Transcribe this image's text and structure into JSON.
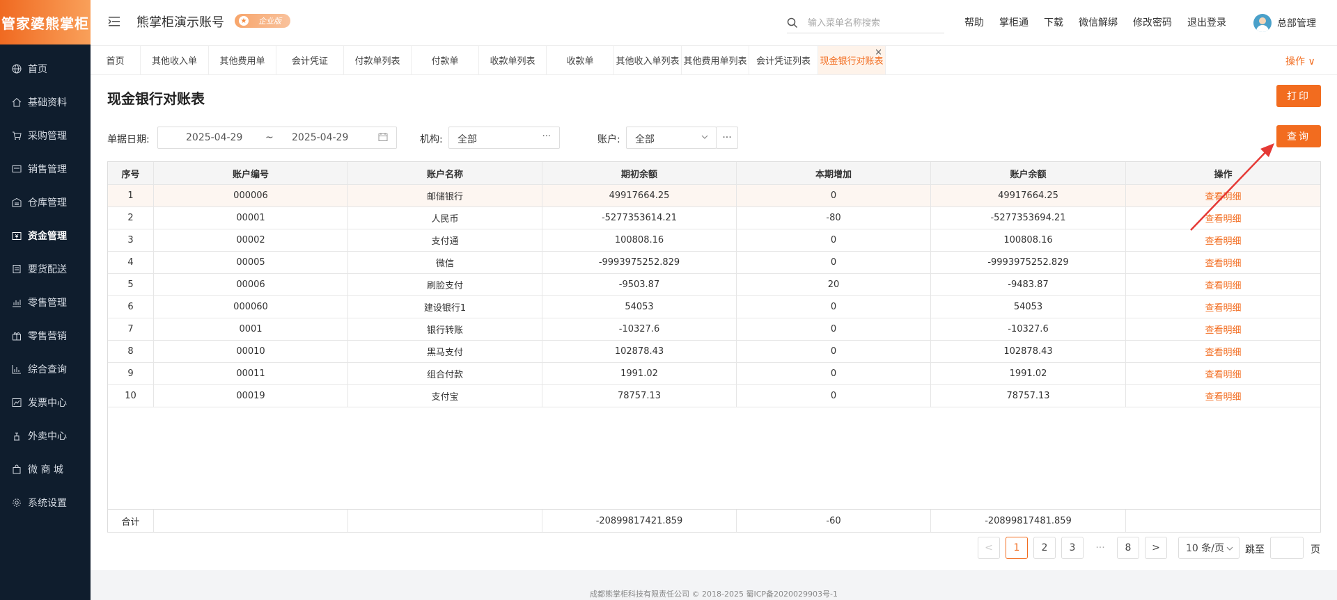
{
  "sidebar": {
    "logo": "管家婆熊掌柜",
    "items": [
      {
        "label": "首页",
        "icon": "globe-icon"
      },
      {
        "label": "基础资料",
        "icon": "home-icon"
      },
      {
        "label": "采购管理",
        "icon": "cart-icon"
      },
      {
        "label": "销售管理",
        "icon": "sales-icon"
      },
      {
        "label": "仓库管理",
        "icon": "warehouse-icon"
      },
      {
        "label": "资金管理",
        "icon": "funds-icon"
      },
      {
        "label": "要货配送",
        "icon": "delivery-icon"
      },
      {
        "label": "零售管理",
        "icon": "retail-chart-icon"
      },
      {
        "label": "零售营销",
        "icon": "gift-icon"
      },
      {
        "label": "综合查询",
        "icon": "bar-chart-icon"
      },
      {
        "label": "发票中心",
        "icon": "line-chart-icon"
      },
      {
        "label": "外卖中心",
        "icon": "takeout-icon"
      },
      {
        "label": "微 商 城",
        "icon": "shop-bag-icon"
      },
      {
        "label": "系统设置",
        "icon": "gear-icon"
      }
    ]
  },
  "header": {
    "account_title": "熊掌柜演示账号",
    "edition_badge": "企业版",
    "search_placeholder": "输入菜单名称搜索",
    "links": [
      "帮助",
      "掌柜通",
      "下载",
      "微信解绑",
      "修改密码",
      "退出登录"
    ],
    "user_name": "总部管理"
  },
  "tabs": {
    "items": [
      "首页",
      "其他收入单",
      "其他费用单",
      "会计凭证",
      "付款单列表",
      "付款单",
      "收款单列表",
      "收款单",
      "其他收入单列表",
      "其他费用单列表",
      "会计凭证列表",
      "现金银行对账表"
    ],
    "active_index": 11,
    "ops_label": "操作 ∨"
  },
  "page": {
    "title": "现金银行对账表",
    "print_button": "打印",
    "query_button": "查询"
  },
  "filters": {
    "date_label": "单据日期:",
    "date_start": "2025-04-29",
    "date_sep": "~",
    "date_end": "2025-04-29",
    "org_label": "机构:",
    "org_value": "全部",
    "account_label": "账户:",
    "account_value": "全部",
    "more": "···"
  },
  "table": {
    "headers": [
      "序号",
      "账户编号",
      "账户名称",
      "期初余额",
      "本期增加",
      "账户余额",
      "操作"
    ],
    "rows": [
      [
        "1",
        "000006",
        "邮储银行",
        "49917664.25",
        "0",
        "49917664.25",
        "查看明细"
      ],
      [
        "2",
        "00001",
        "人民币",
        "-5277353614.21",
        "-80",
        "-5277353694.21",
        "查看明细"
      ],
      [
        "3",
        "00002",
        "支付通",
        "100808.16",
        "0",
        "100808.16",
        "查看明细"
      ],
      [
        "4",
        "00005",
        "微信",
        "-9993975252.829",
        "0",
        "-9993975252.829",
        "查看明细"
      ],
      [
        "5",
        "00006",
        "刷脸支付",
        "-9503.87",
        "20",
        "-9483.87",
        "查看明细"
      ],
      [
        "6",
        "000060",
        "建设银行1",
        "54053",
        "0",
        "54053",
        "查看明细"
      ],
      [
        "7",
        "0001",
        "银行转账",
        "-10327.6",
        "0",
        "-10327.6",
        "查看明细"
      ],
      [
        "8",
        "00010",
        "黑马支付",
        "102878.43",
        "0",
        "102878.43",
        "查看明细"
      ],
      [
        "9",
        "00011",
        "组合付款",
        "1991.02",
        "0",
        "1991.02",
        "查看明细"
      ],
      [
        "10",
        "00019",
        "支付宝",
        "78757.13",
        "0",
        "78757.13",
        "查看明细"
      ]
    ],
    "summary": {
      "label": "合计",
      "opening": "-20899817421.859",
      "increase": "-60",
      "balance": "-20899817481.859"
    }
  },
  "pagination": {
    "prev": "<",
    "pages": [
      "1",
      "2",
      "3"
    ],
    "ellipsis": "···",
    "last": "8",
    "next": ">",
    "current": "1",
    "page_size": "10 条/页",
    "jump_label": "跳至",
    "page_unit": "页"
  },
  "footer": {
    "text": "成都熊掌柜科技有限责任公司 © 2018-2025 蜀ICP备2020029903号-1"
  },
  "colors": {
    "accent": "#f26c1f",
    "sidebar_bg": "#0f1d2d",
    "annotation_arrow": "#e53935"
  }
}
